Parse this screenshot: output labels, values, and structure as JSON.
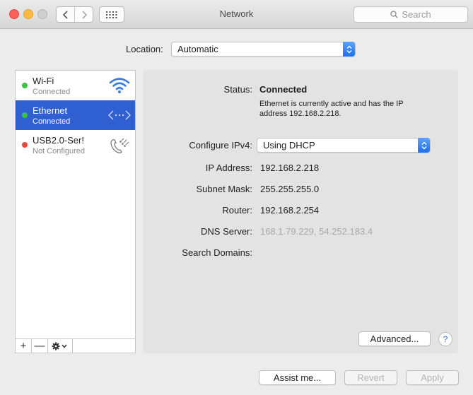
{
  "window": {
    "title": "Network"
  },
  "search": {
    "placeholder": "Search"
  },
  "location": {
    "label": "Location:",
    "value": "Automatic"
  },
  "services": [
    {
      "name": "Wi-Fi",
      "status": "Connected",
      "status_color": "#3cc43c",
      "icon": "wifi-icon"
    },
    {
      "name": "Ethernet",
      "status": "Connected",
      "status_color": "#3cc43c",
      "icon": "ethernet-icon",
      "selected": true
    },
    {
      "name": "USB2.0-Ser!",
      "status": "Not Configured",
      "status_color": "#e24a44",
      "icon": "phone-modem-icon"
    }
  ],
  "sidebar_toolbar": {
    "add": "+",
    "remove": "—"
  },
  "detail": {
    "status_label": "Status:",
    "status_value": "Connected",
    "status_desc": "Ethernet is currently active and has the IP address 192.168.2.218.",
    "configure_label": "Configure IPv4:",
    "configure_value": "Using DHCP",
    "ip_label": "IP Address:",
    "ip_value": "192.168.2.218",
    "subnet_label": "Subnet Mask:",
    "subnet_value": "255.255.255.0",
    "router_label": "Router:",
    "router_value": "192.168.2.254",
    "dns_label": "DNS Server:",
    "dns_value": "168.1.79.229, 54.252.183.4",
    "search_domains_label": "Search Domains:",
    "advanced_button": "Advanced...",
    "help": "?"
  },
  "footer": {
    "assist": "Assist me...",
    "revert": "Revert",
    "apply": "Apply"
  },
  "colors": {
    "accent": "#2f5fd0",
    "popup_arrow": "#1e6ff0"
  }
}
